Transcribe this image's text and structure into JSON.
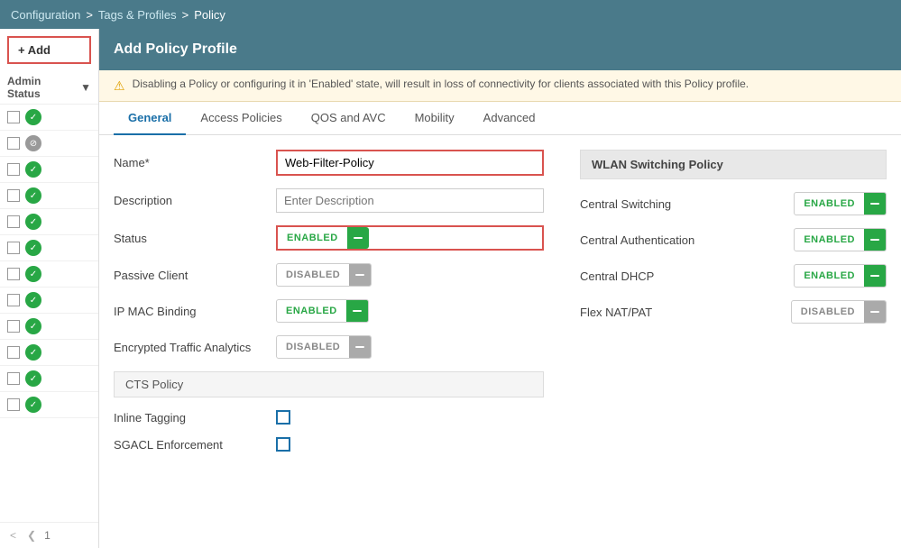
{
  "breadcrumb": {
    "config": "Configuration",
    "sep1": ">",
    "tags": "Tags & Profiles",
    "sep2": ">",
    "current": "Policy"
  },
  "sidebar": {
    "add_label": "+ Add",
    "header_label": "Admin Status",
    "rows": [
      {
        "status": "green"
      },
      {
        "status": "grey"
      },
      {
        "status": "green"
      },
      {
        "status": "green"
      },
      {
        "status": "green"
      },
      {
        "status": "green"
      },
      {
        "status": "green"
      },
      {
        "status": "green"
      },
      {
        "status": "green"
      },
      {
        "status": "green"
      },
      {
        "status": "green"
      },
      {
        "status": "green"
      }
    ],
    "page": "1"
  },
  "header": {
    "title": "Add Policy Profile"
  },
  "alert": {
    "text": "Disabling a Policy or configuring it in 'Enabled' state, will result in loss of connectivity for clients associated with this Policy profile."
  },
  "tabs": [
    {
      "label": "General",
      "active": true
    },
    {
      "label": "Access Policies",
      "active": false
    },
    {
      "label": "QOS and AVC",
      "active": false
    },
    {
      "label": "Mobility",
      "active": false
    },
    {
      "label": "Advanced",
      "active": false
    }
  ],
  "form": {
    "name_label": "Name*",
    "name_value": "Web-Filter-Policy",
    "desc_label": "Description",
    "desc_placeholder": "Enter Description",
    "status_label": "Status",
    "status_value": "ENABLED",
    "passive_label": "Passive Client",
    "passive_value": "DISABLED",
    "ipmac_label": "IP MAC Binding",
    "ipmac_value": "ENABLED",
    "eta_label": "Encrypted Traffic Analytics",
    "eta_value": "DISABLED",
    "cts_header": "CTS Policy",
    "inline_label": "Inline Tagging",
    "sgacl_label": "SGACL Enforcement"
  },
  "wlan": {
    "header": "WLAN Switching Policy",
    "central_switching_label": "Central Switching",
    "central_switching_value": "ENABLED",
    "central_auth_label": "Central Authentication",
    "central_auth_value": "ENABLED",
    "central_dhcp_label": "Central DHCP",
    "central_dhcp_value": "ENABLED",
    "flex_nat_label": "Flex NAT/PAT",
    "flex_nat_value": "DISABLED"
  },
  "colors": {
    "enabled_green": "#28a745",
    "disabled_grey": "#aaa",
    "accent_blue": "#1a6fa8",
    "header_teal": "#4a7a8a",
    "red_border": "#d9534f"
  }
}
